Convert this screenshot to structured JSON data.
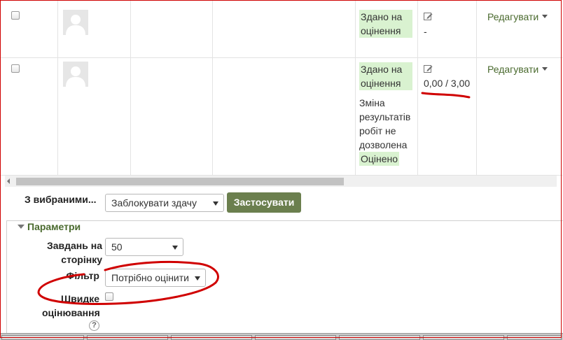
{
  "rows": [
    {
      "status": "Здано на оцінення",
      "grade": "-",
      "note": "",
      "note_status": "",
      "edit_label": "Редагувати"
    },
    {
      "status": "Здано на оцінення",
      "grade": "0,00 / 3,00",
      "note": "Зміна результатів робіт не дозволена",
      "note_status": "Оцінено",
      "edit_label": "Редагувати"
    }
  ],
  "bulk": {
    "label": "З вибраними...",
    "selected": "Заблокувати здачу",
    "apply_label": "Застосувати"
  },
  "options": {
    "legend": "Параметри",
    "per_page_label": "Завдань на сторінку",
    "per_page_value": "50",
    "filter_label": "Фільтр",
    "filter_value": "Потрібно оцінити",
    "quick_label": "Швидке оцінювання"
  },
  "colors": {
    "accent": "#6b7f4e",
    "link": "#4a6a2e",
    "status_bg": "#d9f2d0",
    "annotation": "#d00000"
  },
  "icons": {
    "edit": "pencil-icon",
    "help": "help-icon",
    "caret": "caret-down-icon"
  }
}
